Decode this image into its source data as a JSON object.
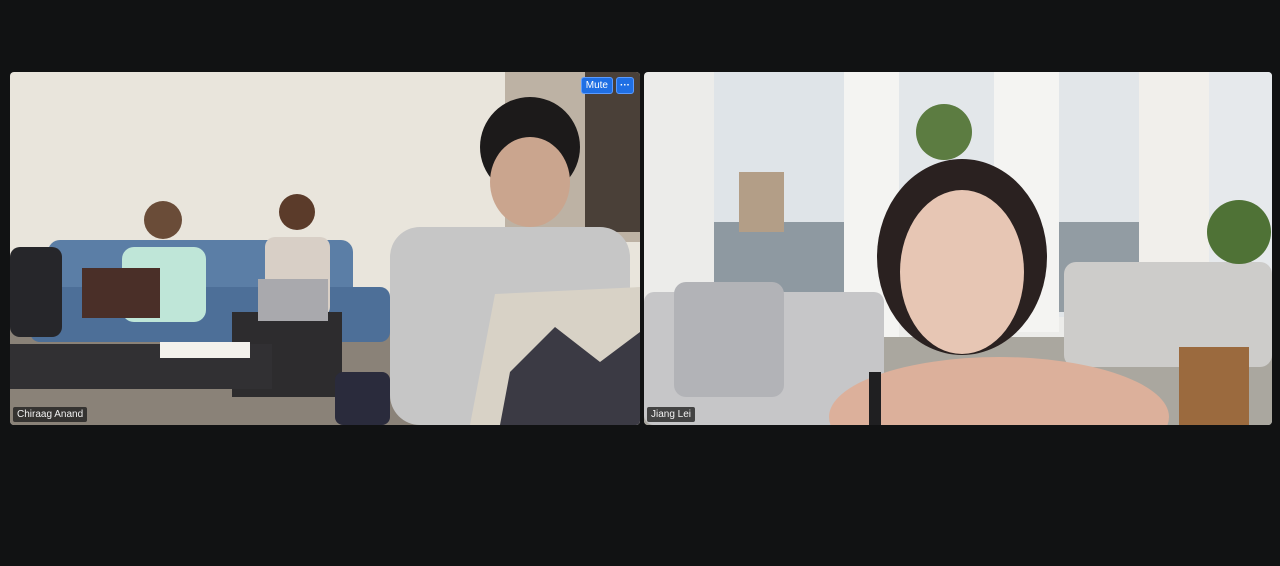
{
  "gallery": {
    "participants": [
      {
        "name": "Chiraag Anand"
      },
      {
        "name": "Jiang Lei"
      }
    ]
  },
  "tile_controls": {
    "mute_label": "Mute",
    "more_label": "···"
  },
  "colors": {
    "background": "#111213",
    "accent": "#1f6fe4",
    "name_tag_bg": "#1e1e1e"
  },
  "icons": [
    "more-options-icon"
  ]
}
